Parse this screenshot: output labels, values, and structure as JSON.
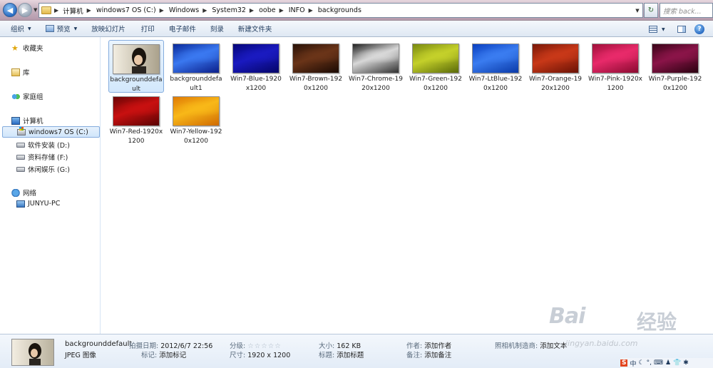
{
  "address": {
    "back_icon": "arrow-left-icon",
    "forward_icon": "arrow-right-icon",
    "crumbs": [
      "计算机",
      "windows7  OS (C:)",
      "Windows",
      "System32",
      "oobe",
      "INFO",
      "backgrounds"
    ],
    "search_placeholder": "搜索 back..."
  },
  "toolbar": {
    "organize": "组织",
    "preview": "预览",
    "slideshow": "放映幻灯片",
    "print": "打印",
    "email": "电子邮件",
    "burn": "刻录",
    "new_folder": "新建文件夹"
  },
  "nav": {
    "favorites": "收藏夹",
    "libraries": "库",
    "homegroup": "家庭组",
    "computer": "计算机",
    "drive_c": "windows7  OS (C:)",
    "drive_d": "软件安装 (D:)",
    "drive_f": "资料存储 (F:)",
    "drive_g": "休闲娱乐 (G:)",
    "network": "网络",
    "pc": "JUNYU-PC"
  },
  "files": [
    {
      "name": "backgrounddefault",
      "colors": [
        "#3b3a34",
        "#cfc6b2",
        "#1b1a14"
      ]
    },
    {
      "name": "backgrounddefault1",
      "colors": [
        "#0a2a9a",
        "#3a78f0",
        "#0b1f8a"
      ]
    },
    {
      "name": "Win7-Blue-1920x1200",
      "colors": [
        "#05067a",
        "#1a1ac0",
        "#050568"
      ]
    },
    {
      "name": "Win7-Brown-1920x1200",
      "colors": [
        "#2a1208",
        "#6a3418",
        "#1a0a04"
      ]
    },
    {
      "name": "Win7-Chrome-1920x1200",
      "colors": [
        "#202020",
        "#d8d8d8",
        "#303030"
      ]
    },
    {
      "name": "Win7-Green-1920x1200",
      "colors": [
        "#7a8a10",
        "#c4d02a",
        "#5a6a08"
      ]
    },
    {
      "name": "Win7-LtBlue-1920x1200",
      "colors": [
        "#0a40c0",
        "#3a7cf0",
        "#0a3aa8"
      ]
    },
    {
      "name": "Win7-Orange-1920x1200",
      "colors": [
        "#7a1808",
        "#c83818",
        "#6a1205"
      ]
    },
    {
      "name": "Win7-Pink-1920x1200",
      "colors": [
        "#a0103a",
        "#e82a6a",
        "#8a0a30"
      ]
    },
    {
      "name": "Win7-Purple-1920x1200",
      "colors": [
        "#3a0418",
        "#8a1448",
        "#2a0210"
      ]
    },
    {
      "name": "Win7-Red-1920x1200",
      "colors": [
        "#6a0404",
        "#c81010",
        "#5a0303"
      ]
    },
    {
      "name": "Win7-Yellow-1920x1200",
      "colors": [
        "#e07a04",
        "#f8b818",
        "#d06a02"
      ]
    }
  ],
  "details": {
    "filename": "backgrounddefault",
    "filetype": "JPEG 图像",
    "date_label": "拍摄日期:",
    "date_value": "2012/6/7 22:56",
    "tags_label": "标记:",
    "tags_value": "添加标记",
    "rating_label": "分级:",
    "rating_value": 0,
    "rating_stars": "☆☆☆☆☆",
    "dims_label": "尺寸:",
    "dims_value": "1920 x 1200",
    "size_label": "大小:",
    "size_value": "162 KB",
    "title_label": "标题:",
    "title_value": "添加标题",
    "author_label": "作者:",
    "author_value": "添加作者",
    "comments_label": "备注:",
    "comments_value": "添加备注",
    "camera_label": "照相机制造商:",
    "camera_value": "添加文本"
  },
  "watermark": {
    "brand": "Bai",
    "brand2": "经验",
    "url": "jingyan.baidu.com"
  },
  "tray": {
    "ime": "中"
  }
}
